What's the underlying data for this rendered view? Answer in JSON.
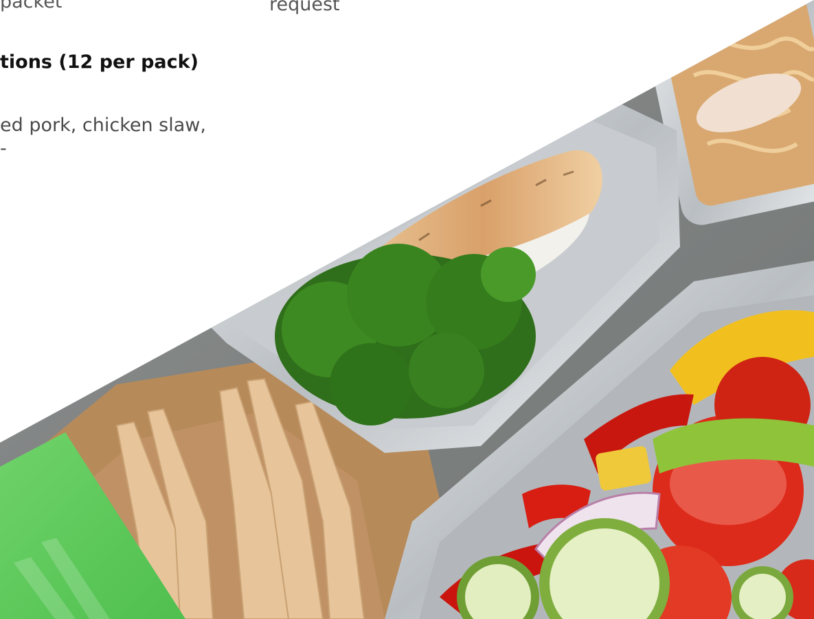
{
  "text": {
    "line_packet": "packet",
    "line_request": "request",
    "heading_options": "tions (12 per pack)",
    "line_fillings": "ed pork, chicken slaw,",
    "line_fillings_tail": "-"
  },
  "colors": {
    "accent_green": "#5ecb5c",
    "background": "#ffffff"
  },
  "image": {
    "subject": "takeaway foil trays with grilled chicken, broccoli, noodles and vegetable salad beside wooden forks"
  }
}
